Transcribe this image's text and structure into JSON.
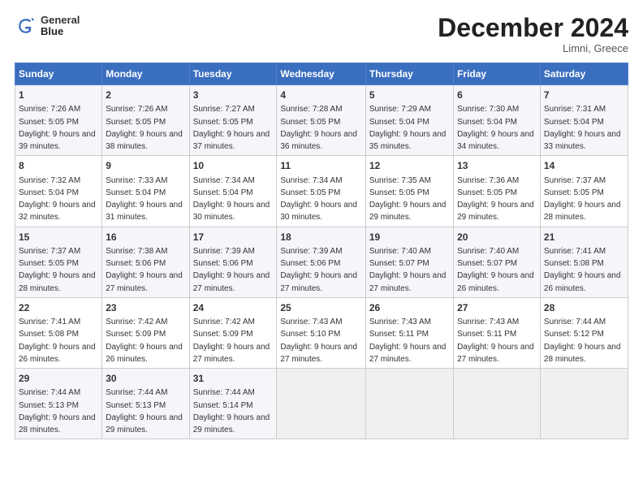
{
  "logo": {
    "line1": "General",
    "line2": "Blue"
  },
  "title": "December 2024",
  "subtitle": "Limni, Greece",
  "days_of_week": [
    "Sunday",
    "Monday",
    "Tuesday",
    "Wednesday",
    "Thursday",
    "Friday",
    "Saturday"
  ],
  "weeks": [
    [
      {
        "day": "1",
        "sunrise": "7:26 AM",
        "sunset": "5:05 PM",
        "daylight": "9 hours and 39 minutes."
      },
      {
        "day": "2",
        "sunrise": "7:26 AM",
        "sunset": "5:05 PM",
        "daylight": "9 hours and 38 minutes."
      },
      {
        "day": "3",
        "sunrise": "7:27 AM",
        "sunset": "5:05 PM",
        "daylight": "9 hours and 37 minutes."
      },
      {
        "day": "4",
        "sunrise": "7:28 AM",
        "sunset": "5:05 PM",
        "daylight": "9 hours and 36 minutes."
      },
      {
        "day": "5",
        "sunrise": "7:29 AM",
        "sunset": "5:04 PM",
        "daylight": "9 hours and 35 minutes."
      },
      {
        "day": "6",
        "sunrise": "7:30 AM",
        "sunset": "5:04 PM",
        "daylight": "9 hours and 34 minutes."
      },
      {
        "day": "7",
        "sunrise": "7:31 AM",
        "sunset": "5:04 PM",
        "daylight": "9 hours and 33 minutes."
      }
    ],
    [
      {
        "day": "8",
        "sunrise": "7:32 AM",
        "sunset": "5:04 PM",
        "daylight": "9 hours and 32 minutes."
      },
      {
        "day": "9",
        "sunrise": "7:33 AM",
        "sunset": "5:04 PM",
        "daylight": "9 hours and 31 minutes."
      },
      {
        "day": "10",
        "sunrise": "7:34 AM",
        "sunset": "5:04 PM",
        "daylight": "9 hours and 30 minutes."
      },
      {
        "day": "11",
        "sunrise": "7:34 AM",
        "sunset": "5:05 PM",
        "daylight": "9 hours and 30 minutes."
      },
      {
        "day": "12",
        "sunrise": "7:35 AM",
        "sunset": "5:05 PM",
        "daylight": "9 hours and 29 minutes."
      },
      {
        "day": "13",
        "sunrise": "7:36 AM",
        "sunset": "5:05 PM",
        "daylight": "9 hours and 29 minutes."
      },
      {
        "day": "14",
        "sunrise": "7:37 AM",
        "sunset": "5:05 PM",
        "daylight": "9 hours and 28 minutes."
      }
    ],
    [
      {
        "day": "15",
        "sunrise": "7:37 AM",
        "sunset": "5:05 PM",
        "daylight": "9 hours and 28 minutes."
      },
      {
        "day": "16",
        "sunrise": "7:38 AM",
        "sunset": "5:06 PM",
        "daylight": "9 hours and 27 minutes."
      },
      {
        "day": "17",
        "sunrise": "7:39 AM",
        "sunset": "5:06 PM",
        "daylight": "9 hours and 27 minutes."
      },
      {
        "day": "18",
        "sunrise": "7:39 AM",
        "sunset": "5:06 PM",
        "daylight": "9 hours and 27 minutes."
      },
      {
        "day": "19",
        "sunrise": "7:40 AM",
        "sunset": "5:07 PM",
        "daylight": "9 hours and 27 minutes."
      },
      {
        "day": "20",
        "sunrise": "7:40 AM",
        "sunset": "5:07 PM",
        "daylight": "9 hours and 26 minutes."
      },
      {
        "day": "21",
        "sunrise": "7:41 AM",
        "sunset": "5:08 PM",
        "daylight": "9 hours and 26 minutes."
      }
    ],
    [
      {
        "day": "22",
        "sunrise": "7:41 AM",
        "sunset": "5:08 PM",
        "daylight": "9 hours and 26 minutes."
      },
      {
        "day": "23",
        "sunrise": "7:42 AM",
        "sunset": "5:09 PM",
        "daylight": "9 hours and 26 minutes."
      },
      {
        "day": "24",
        "sunrise": "7:42 AM",
        "sunset": "5:09 PM",
        "daylight": "9 hours and 27 minutes."
      },
      {
        "day": "25",
        "sunrise": "7:43 AM",
        "sunset": "5:10 PM",
        "daylight": "9 hours and 27 minutes."
      },
      {
        "day": "26",
        "sunrise": "7:43 AM",
        "sunset": "5:11 PM",
        "daylight": "9 hours and 27 minutes."
      },
      {
        "day": "27",
        "sunrise": "7:43 AM",
        "sunset": "5:11 PM",
        "daylight": "9 hours and 27 minutes."
      },
      {
        "day": "28",
        "sunrise": "7:44 AM",
        "sunset": "5:12 PM",
        "daylight": "9 hours and 28 minutes."
      }
    ],
    [
      {
        "day": "29",
        "sunrise": "7:44 AM",
        "sunset": "5:13 PM",
        "daylight": "9 hours and 28 minutes."
      },
      {
        "day": "30",
        "sunrise": "7:44 AM",
        "sunset": "5:13 PM",
        "daylight": "9 hours and 29 minutes."
      },
      {
        "day": "31",
        "sunrise": "7:44 AM",
        "sunset": "5:14 PM",
        "daylight": "9 hours and 29 minutes."
      },
      null,
      null,
      null,
      null
    ]
  ]
}
